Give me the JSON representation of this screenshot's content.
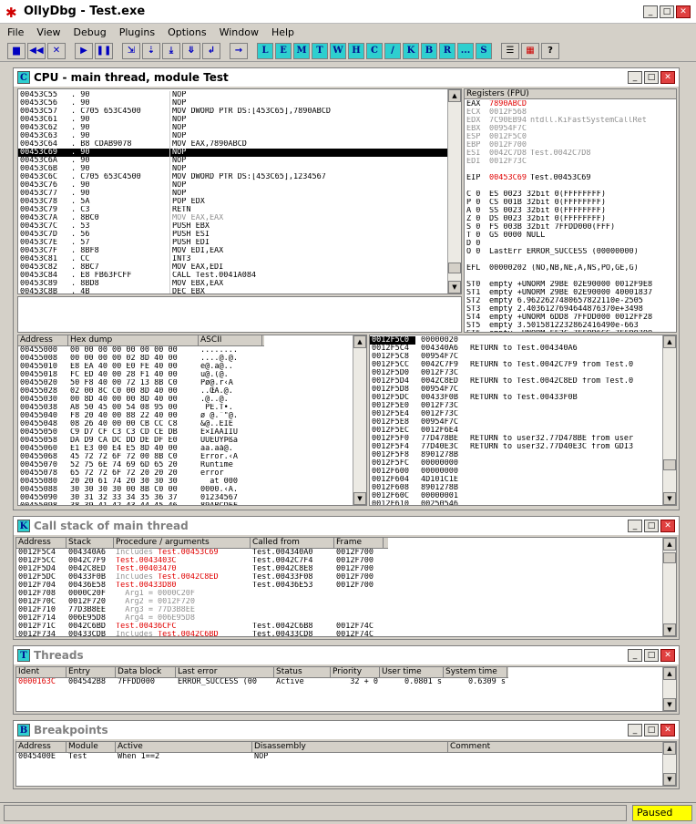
{
  "app": {
    "title": "OllyDbg - Test.exe",
    "status": "Paused"
  },
  "menu": [
    "File",
    "View",
    "Debug",
    "Plugins",
    "Options",
    "Window",
    "Help"
  ],
  "toolbar": {
    "icons": [
      "open-icon",
      "rewind-icon",
      "close-icon",
      "run-icon",
      "pause-icon",
      "step-into-icon",
      "step-over-icon",
      "trace-into-icon",
      "trace-over-icon",
      "execute-till-return-icon",
      "goto-icon"
    ],
    "letters": [
      "L",
      "E",
      "M",
      "T",
      "W",
      "H",
      "C",
      "/",
      "K",
      "B",
      "R",
      "...",
      "S"
    ]
  },
  "cpu": {
    "title": "CPU - main thread, module Test",
    "disasm": [
      [
        "00453C55",
        ". 90",
        "",
        "NOP",
        ""
      ],
      [
        "00453C56",
        ". 90",
        "",
        "NOP",
        ""
      ],
      [
        "00453C57",
        ". C705 653C4500",
        "653C4500",
        "MOV DWORD PTR DS:[453C65],7890ABCD",
        ""
      ],
      [
        "00453C61",
        ". 90",
        "",
        "NOP",
        ""
      ],
      [
        "00453C62",
        ". 90",
        "",
        "NOP",
        ""
      ],
      [
        "00453C63",
        ". 90",
        "",
        "NOP",
        ""
      ],
      [
        "00453C64",
        ". B8 CDAB9078",
        "",
        "MOV EAX,7890ABCD",
        ""
      ],
      [
        "00453C69",
        ". 90",
        "",
        "NOP",
        "sel"
      ],
      [
        "00453C6A",
        ". 90",
        "",
        "NOP",
        ""
      ],
      [
        "00453C6B",
        ". 90",
        "",
        "NOP",
        ""
      ],
      [
        "00453C6C",
        ". C705 653C4500",
        "653C4500",
        "MOV DWORD PTR DS:[453C65],1234567",
        ""
      ],
      [
        "00453C76",
        ". 90",
        "",
        "NOP",
        ""
      ],
      [
        "00453C77",
        ". 90",
        "",
        "NOP",
        ""
      ],
      [
        "00453C78",
        ". 5A",
        "",
        "POP EDX",
        ""
      ],
      [
        "00453C79",
        ". C3",
        "",
        "RETN",
        ""
      ],
      [
        "00453C7A",
        ". 8BC0",
        "",
        "MOV EAX,EAX",
        "gray"
      ],
      [
        "00453C7C",
        ". 53",
        "",
        "PUSH EBX",
        ""
      ],
      [
        "00453C7D",
        ". 56",
        "",
        "PUSH ESI",
        ""
      ],
      [
        "00453C7E",
        ". 57",
        "",
        "PUSH EDI",
        ""
      ],
      [
        "00453C7F",
        ". 8BF8",
        "",
        "MOV EDI,EAX",
        ""
      ],
      [
        "00453C81",
        ". CC",
        "",
        "INT3",
        ""
      ],
      [
        "00453C82",
        ". 8BC7",
        "",
        "MOV EAX,EDI",
        ""
      ],
      [
        "00453C84",
        ". E8 FB63FCFF",
        "",
        "CALL Test.0041A084",
        ""
      ],
      [
        "00453C89",
        ". 8BD8",
        "",
        "MOV EBX,EAX",
        ""
      ],
      [
        "00453C8B",
        ". 4B",
        "",
        "DEC EBX",
        ""
      ]
    ],
    "registers_title": "Registers (FPU)",
    "registers": [
      [
        "EAX",
        "7890ABCD",
        "",
        "red"
      ],
      [
        "ECX",
        "0012F568",
        "",
        "gray"
      ],
      [
        "EDX",
        "7C90EB94",
        "ntdll.KiFastSystemCallRet",
        "gray"
      ],
      [
        "EBX",
        "00954F7C",
        "",
        "gray"
      ],
      [
        "ESP",
        "0012F5C0",
        "",
        "gray"
      ],
      [
        "EBP",
        "0012F700",
        "",
        "gray"
      ],
      [
        "ESI",
        "0042C7D8",
        "Test.0042C7D8",
        "gray"
      ],
      [
        "EDI",
        "0012F73C",
        "",
        "gray"
      ],
      [
        "",
        "",
        "",
        ""
      ],
      [
        "EIP",
        "00453C69",
        "Test.00453C69",
        "eip"
      ],
      [
        "",
        "",
        "",
        ""
      ],
      [
        "C 0",
        "ES 0023 32bit 0(FFFFFFFF)",
        "",
        ""
      ],
      [
        "P 0",
        "CS 001B 32bit 0(FFFFFFFF)",
        "",
        ""
      ],
      [
        "A 0",
        "SS 0023 32bit 0(FFFFFFFF)",
        "",
        ""
      ],
      [
        "Z 0",
        "DS 0023 32bit 0(FFFFFFFF)",
        "",
        ""
      ],
      [
        "S 0",
        "FS 003B 32bit 7FFDD000(FFF)",
        "",
        ""
      ],
      [
        "T 0",
        "GS 0000 NULL",
        "",
        ""
      ],
      [
        "D 0",
        "",
        "",
        ""
      ],
      [
        "O 0",
        "LastErr ERROR_SUCCESS (00000000)",
        "",
        ""
      ],
      [
        "",
        "",
        "",
        ""
      ],
      [
        "EFL",
        "00000202 (NO,NB,NE,A,NS,PO,GE,G)",
        "",
        ""
      ],
      [
        "",
        "",
        "",
        ""
      ],
      [
        "ST0",
        "empty +UNORM 29BE 02E90000 0012F9E8",
        "",
        ""
      ],
      [
        "ST1",
        "empty +UNORM 29BE 02E90000 40001837",
        "",
        ""
      ],
      [
        "ST2",
        "empty 6.9622627480657822110e-2505",
        "",
        ""
      ],
      [
        "ST3",
        "empty 2.4036127694644876370e+3498",
        "",
        ""
      ],
      [
        "ST4",
        "empty +UNORM 6DD8 7FFDD000 0012FF28",
        "",
        ""
      ],
      [
        "ST5",
        "empty 3.5015812232862416490e-663",
        "",
        ""
      ],
      [
        "ST6",
        "empty -UNORM FF2C 7FFDD6CC 7FFD0700",
        "",
        ""
      ],
      [
        "ST7",
        "empty -UNORM D700 00000018 85453020",
        "",
        ""
      ]
    ],
    "dump_headers": [
      "Address",
      "Hex dump",
      "ASCII"
    ],
    "dump": [
      [
        "00455000",
        "00 00 00 00 00 00 00 00",
        "........"
      ],
      [
        "00455008",
        "00 00 00 00 02 8D 40 00",
        "....@.@."
      ],
      [
        "00455010",
        "E8 EA 40 00 E0 FE 40 00",
        "è@.à@.."
      ],
      [
        "00455018",
        "FC ED 40 00 28 F1 40 00",
        "ü@.(@."
      ],
      [
        "00455020",
        "50 F8 40 00 72 13 8B C0",
        "Pø@.r‹À"
      ],
      [
        "00455028",
        "02 00 8C C0 00 8D 40 00",
        "..ŒÀ.@."
      ],
      [
        "00455030",
        "00 8D 40 00 00 8D 40 00",
        ".@..@."
      ],
      [
        "00455038",
        "A8 50 45 00 54 08 95 00",
        "¨PE.T•."
      ],
      [
        "00455040",
        "F8 20 40 00 88 22 40 00",
        "ø @.ˆ\"@."
      ],
      [
        "00455048",
        "08 26 40 00 00 CB CC C8",
        "&@..ËÌÈ"
      ],
      [
        "00455050",
        "C9 D7 CF C3 C3 CD CE DB",
        "É×ÏÃÃÍÎÛ"
      ],
      [
        "00455058",
        "DA D9 CA DC DD DE DF E0",
        "ÚÙÊÜÝÞßà"
      ],
      [
        "00455060",
        "E1 E3 00 E4 E5 8D 40 00",
        "áã.äå@."
      ],
      [
        "00455068",
        "45 72 72 6F 72 00 8B C0",
        "Error.‹À"
      ],
      [
        "00455070",
        "52 75 6E 74 69 6D 65 20",
        "Runtime "
      ],
      [
        "00455078",
        "65 72 72 6F 72 20 20 20",
        "error   "
      ],
      [
        "00455080",
        "20 20 61 74 20 30 30 30",
        "  at 000"
      ],
      [
        "00455088",
        "30 30 30 30 00 8B C0 00",
        "0000.‹À."
      ],
      [
        "00455090",
        "30 31 32 33 34 35 36 37",
        "01234567"
      ],
      [
        "00455098",
        "38 39 41 42 43 44 45 46",
        "89ABCDEF"
      ]
    ],
    "stack": [
      [
        "0012F5C0",
        "00000020",
        ""
      ],
      [
        "0012F5C4",
        "004340A6",
        "RETURN to Test.004340A6"
      ],
      [
        "0012F5C8",
        "00954F7C",
        ""
      ],
      [
        "0012F5CC",
        "0042C7F9",
        "RETURN to Test.0042C7F9 from Test.0"
      ],
      [
        "0012F5D0",
        "0012F73C",
        ""
      ],
      [
        "0012F5D4",
        "0042C8ED",
        "RETURN to Test.0042C8ED from Test.0"
      ],
      [
        "0012F5D8",
        "00954F7C",
        ""
      ],
      [
        "0012F5DC",
        "00433F0B",
        "RETURN to Test.00433F0B"
      ],
      [
        "0012F5E0",
        "0012F73C",
        ""
      ],
      [
        "0012F5E4",
        "0012F73C",
        ""
      ],
      [
        "0012F5E8",
        "00954F7C",
        ""
      ],
      [
        "0012F5EC",
        "0012F6E4",
        ""
      ],
      [
        "0012F5F0",
        "77D478BE",
        "RETURN to user32.77D478BE from user"
      ],
      [
        "0012F5F4",
        "77D40E3C",
        "RETURN to user32.77D40E3C from GDI3"
      ],
      [
        "0012F5F8",
        "8901278B",
        ""
      ],
      [
        "0012F5FC",
        "00000000",
        ""
      ],
      [
        "0012F600",
        "00000000",
        ""
      ],
      [
        "0012F604",
        "4D101C1E",
        ""
      ],
      [
        "0012F608",
        "8901278B",
        ""
      ],
      [
        "0012F60C",
        "00000001",
        ""
      ],
      [
        "0012F610",
        "00250546",
        ""
      ]
    ]
  },
  "callstack": {
    "title": "Call stack of main thread",
    "headers": [
      "Address",
      "Stack",
      "Procedure / arguments",
      "Called from",
      "Frame"
    ],
    "rows": [
      [
        "0012F5C4",
        "004340A6",
        "Includes ",
        "Test.00453C69",
        "Test.004340A0",
        "0012F700"
      ],
      [
        "0012F5CC",
        "0042C7F9",
        "",
        "Test.0043403C",
        "Test.0042C7F4",
        "0012F700"
      ],
      [
        "0012F5D4",
        "0042C8ED",
        "",
        "Test.00403470",
        "Test.0042C8E8",
        "0012F700"
      ],
      [
        "0012F5DC",
        "00433F0B",
        "Includes ",
        "Test.0042C8ED",
        "Test.00433F08",
        "0012F700"
      ],
      [
        "0012F704",
        "00436E58",
        "",
        "Test.00433D80",
        "Test.00436E53",
        "0012F700"
      ],
      [
        "0012F708",
        "0000C20F",
        "  Arg1 = 0000C20F",
        "",
        "",
        ""
      ],
      [
        "0012F70C",
        "0012F720",
        "  Arg2 = 0012F720",
        "",
        "",
        ""
      ],
      [
        "0012F710",
        "77D3B8EE",
        "  Arg3 = 77D3B8EE",
        "",
        "",
        ""
      ],
      [
        "0012F714",
        "006E95D8",
        "  Arg4 = 006E95D8",
        "",
        "",
        ""
      ],
      [
        "0012F71C",
        "0042C6BD",
        "",
        "Test.00436CFC",
        "Test.0042C6B8",
        "0012F74C"
      ],
      [
        "0012F734",
        "00433CDB",
        "Includes ",
        "Test.0042C6BD",
        "Test.00433CD8",
        "0012F74C"
      ]
    ]
  },
  "threads": {
    "title": "Threads",
    "headers": [
      "Ident",
      "Entry",
      "Data block",
      "Last error",
      "Status",
      "Priority",
      "User time",
      "System time"
    ],
    "rows": [
      [
        "0000163C",
        "004542B8",
        "7FFDD000",
        "ERROR_SUCCESS (00",
        "Active",
        "32 + 0",
        "0.0801 s",
        "0.6309 s"
      ]
    ]
  },
  "breakpoints": {
    "title": "Breakpoints",
    "headers": [
      "Address",
      "Module",
      "Active",
      "Disassembly",
      "Comment"
    ],
    "rows": [
      [
        "0045400E",
        "Test",
        "When 1==2",
        "NOP",
        ""
      ]
    ]
  }
}
